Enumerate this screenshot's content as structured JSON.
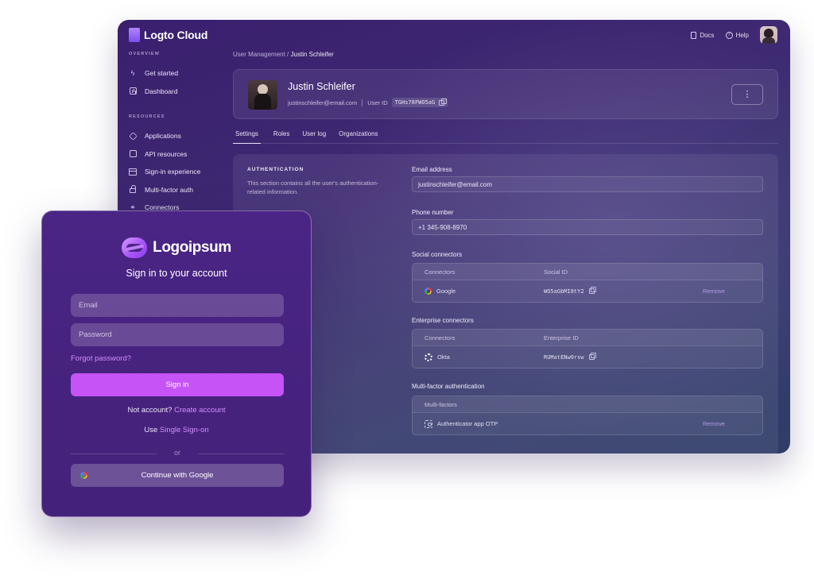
{
  "console": {
    "brand": "Logto Cloud",
    "top_links": {
      "docs": "Docs",
      "help": "Help"
    },
    "sidebar": {
      "overview_title": "OVERVIEW",
      "overview_items": [
        {
          "label": "Get started",
          "icon": "bolt-icon"
        },
        {
          "label": "Dashboard",
          "icon": "chart-icon"
        }
      ],
      "resources_title": "RESOURCES",
      "resources_items": [
        {
          "label": "Applications",
          "icon": "cube-icon"
        },
        {
          "label": "API resources",
          "icon": "api-icon"
        },
        {
          "label": "Sign-in experience",
          "icon": "window-icon"
        },
        {
          "label": "Multi-factor auth",
          "icon": "lock-icon"
        },
        {
          "label": "Connectors",
          "icon": "plug-icon"
        }
      ]
    },
    "breadcrumb": {
      "parent": "User Management",
      "separator": "/",
      "current": "Justin Schleifer"
    },
    "user": {
      "name": "Justin Schleifer",
      "email": "justinschleifer@email.com",
      "user_id_label": "User ID",
      "user_id": "TGHs78FWO5aG"
    },
    "tabs": [
      "Settings",
      "Roles",
      "User log",
      "Organizations"
    ],
    "auth_section": {
      "title": "AUTHENTICATION",
      "description": "This section contains all the user's authentication-related information.",
      "email_label": "Email address",
      "email_value": "justinschleifer@email.com",
      "phone_label": "Phone number",
      "phone_value": "+1 345-908-8970",
      "social": {
        "label": "Social connectors",
        "col1": "Connectors",
        "col2": "Social ID",
        "row": {
          "name": "Google",
          "id": "WO5aGbMI8tY2",
          "action": "Remove"
        }
      },
      "enterprise": {
        "label": "Enterprise connectors",
        "col1": "Connectors",
        "col2": "Enterprise ID",
        "row": {
          "name": "Okta",
          "id": "RUMatENw0rsw"
        }
      },
      "mfa": {
        "label": "Multi-factor authentication",
        "col1": "Multi-factors",
        "row": {
          "name": "Authenticator app OTP",
          "action": "Remove"
        }
      }
    }
  },
  "signin": {
    "logo_text": "Logoipsum",
    "title": "Sign in to your account",
    "email_placeholder": "Email",
    "password_placeholder": "Password",
    "forgot": "Forgot password?",
    "submit": "Sign in",
    "no_account": "Not account?",
    "create_account": "Create account",
    "use": "Use",
    "sso": "Single Sign-on",
    "or": "or",
    "google": "Continue with Google"
  },
  "colors": {
    "accent": "#c653f5",
    "link": "#d58cff",
    "console_bg": "#3e2a72",
    "card_bg": "#47237f"
  }
}
